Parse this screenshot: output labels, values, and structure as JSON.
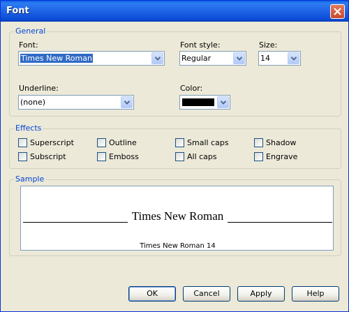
{
  "window": {
    "title": "Font"
  },
  "general": {
    "legend": "General",
    "font_label": "Font:",
    "font_value": "Times New Roman",
    "style_label": "Font style:",
    "style_value": "Regular",
    "size_label": "Size:",
    "size_value": "14",
    "underline_label": "Underline:",
    "underline_value": "(none)",
    "color_label": "Color:",
    "color_value": "#000000"
  },
  "effects": {
    "legend": "Effects",
    "items": [
      {
        "label": "Superscript",
        "checked": false
      },
      {
        "label": "Outline",
        "checked": false
      },
      {
        "label": "Small caps",
        "checked": false
      },
      {
        "label": "Shadow",
        "checked": false
      },
      {
        "label": "Subscript",
        "checked": false
      },
      {
        "label": "Emboss",
        "checked": false
      },
      {
        "label": "All caps",
        "checked": false
      },
      {
        "label": "Engrave",
        "checked": false
      }
    ]
  },
  "sample": {
    "legend": "Sample",
    "preview_text": "Times New Roman",
    "caption": "Times New Roman 14"
  },
  "buttons": {
    "ok": "OK",
    "cancel": "Cancel",
    "apply": "Apply",
    "help": "Help"
  },
  "colors": {
    "title_bar": "#0A5FE6",
    "dialog_bg": "#ECE9D8",
    "legend_text": "#0046D5",
    "selection": "#316AC5"
  }
}
